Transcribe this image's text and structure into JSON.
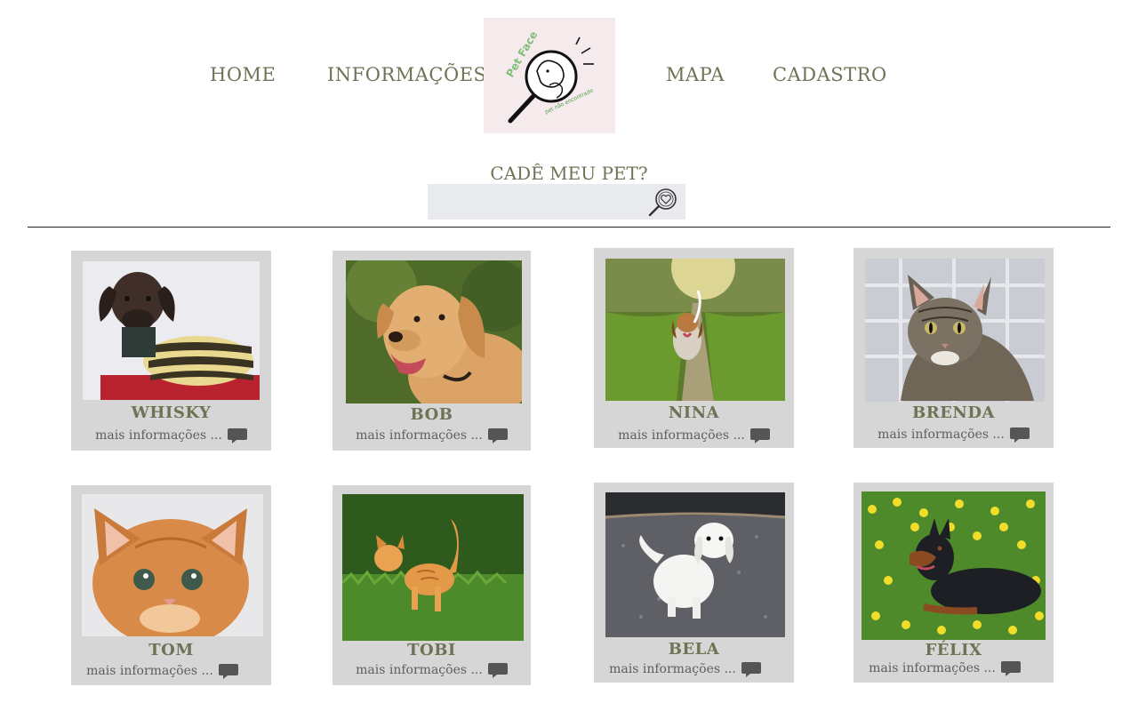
{
  "nav": {
    "home": "HOME",
    "info": "INFORMAÇÕES",
    "map": "MAPA",
    "register": "CADASTRO"
  },
  "logo": {
    "brand": "Pet Face",
    "tagline": "pet não encontrado"
  },
  "search": {
    "title": "CADÊ MEU PET?",
    "placeholder": "",
    "value": ""
  },
  "pets": [
    {
      "name": "WHISKY",
      "more": "mais informações ..."
    },
    {
      "name": "BOB",
      "more": "mais informações ..."
    },
    {
      "name": "NINA",
      "more": "mais informações ..."
    },
    {
      "name": "BRENDA",
      "more": "mais informações ..."
    },
    {
      "name": "TOM",
      "more": "mais informações ..."
    },
    {
      "name": "TOBI",
      "more": "mais informações ..."
    },
    {
      "name": "BELA",
      "more": "mais informações ..."
    },
    {
      "name": "FÉLIX",
      "more": "mais informações ..."
    }
  ],
  "colors": {
    "accent_text": "#6f7355",
    "card_frame": "#d6d6d6",
    "logo_bg": "#f6ebec",
    "search_bg": "#e9eaee"
  }
}
